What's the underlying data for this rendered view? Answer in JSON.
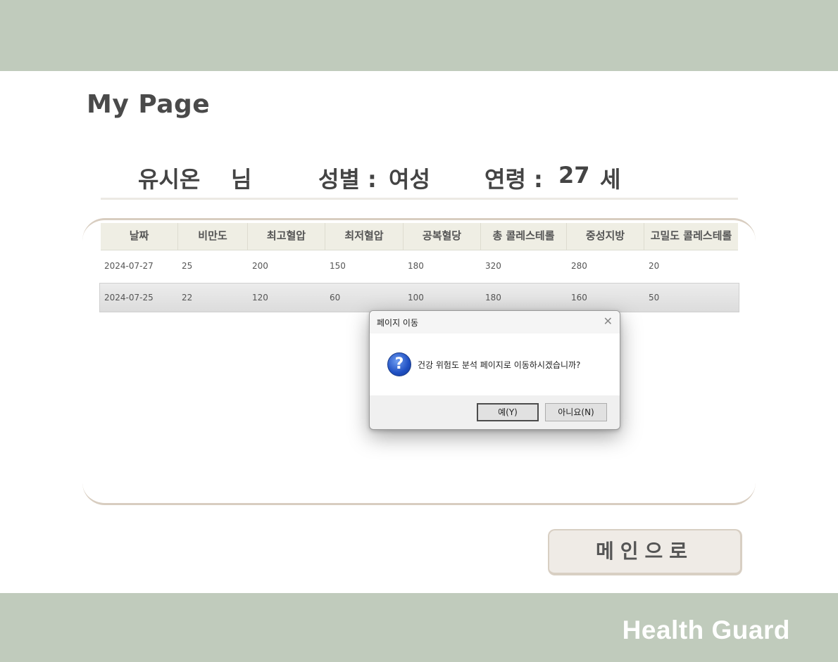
{
  "page": {
    "title": "My Page",
    "brand": "Health Guard",
    "main_button": "메인으로"
  },
  "user": {
    "name": "유시온",
    "honorific": "님",
    "gender_label": "성별 :",
    "gender": "여성",
    "age_label": "연령 :",
    "age": "27",
    "age_unit": "세"
  },
  "table": {
    "columns": [
      "날짜",
      "비만도",
      "최고혈압",
      "최저혈압",
      "공복혈당",
      "총 콜레스테롤",
      "중성지방",
      "고밀도 콜레스테롤"
    ],
    "rows": [
      [
        "2024-07-27",
        "25",
        "200",
        "150",
        "180",
        "320",
        "280",
        "20"
      ],
      [
        "2024-07-25",
        "22",
        "120",
        "60",
        "100",
        "180",
        "160",
        "50"
      ]
    ],
    "selected_row": 1
  },
  "dialog": {
    "title": "페이지 이동",
    "message": "건강 위험도 분석 페이지로 이동하시겠습니까?",
    "icon": "question-icon",
    "yes_label": "예(Y)",
    "no_label": "아니요(N)"
  },
  "colors": {
    "band": "#c0cbbc",
    "frame": "#d8cdc0",
    "header_bg": "#efeee4"
  }
}
